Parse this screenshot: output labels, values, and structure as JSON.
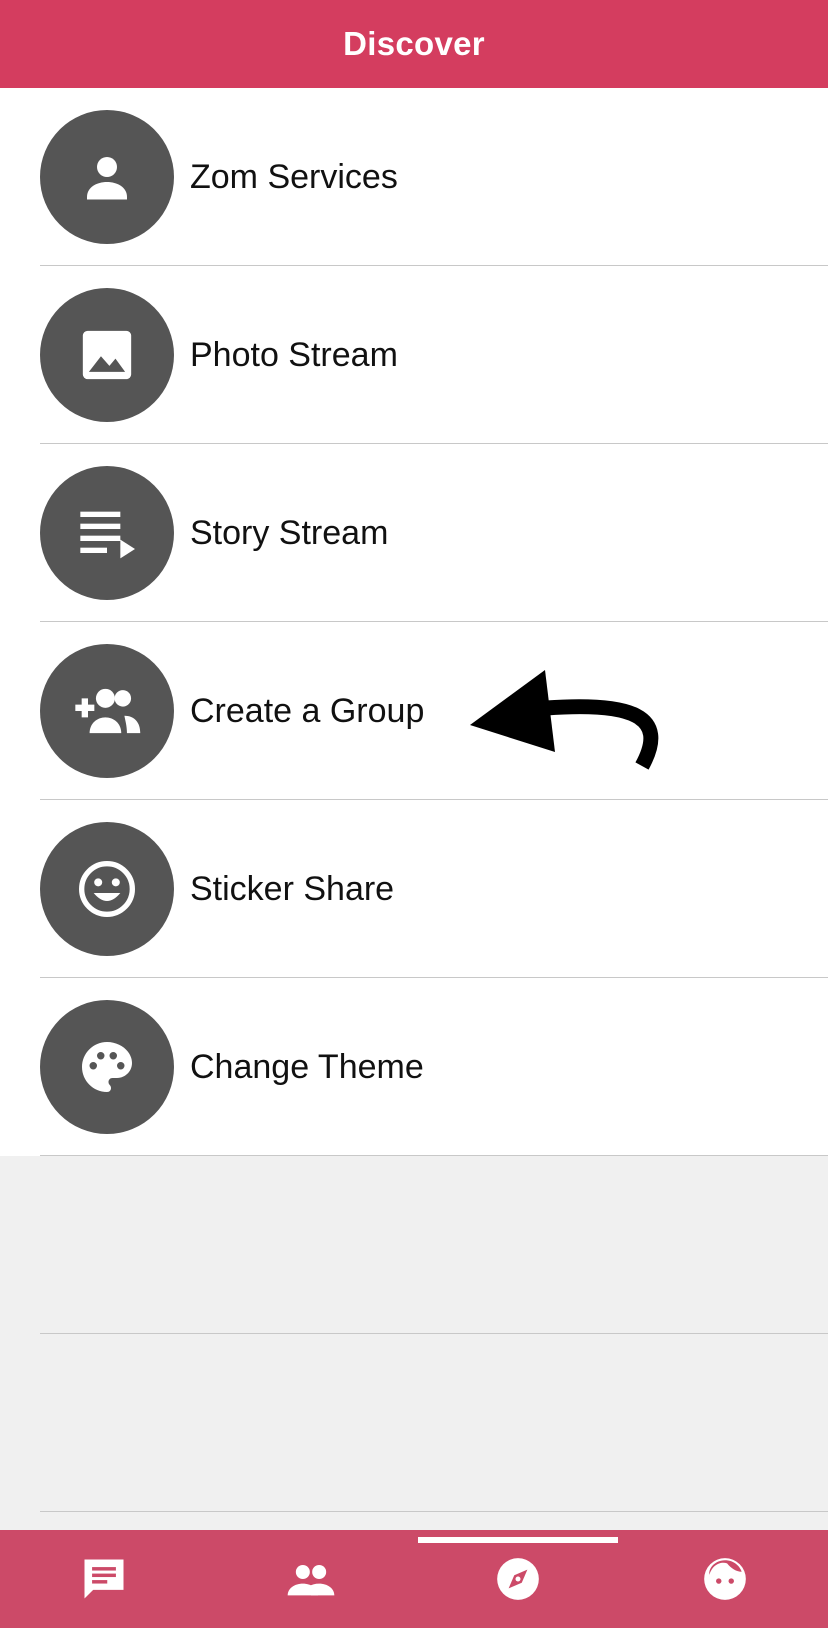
{
  "header": {
    "title": "Discover"
  },
  "items": [
    {
      "label": "Zom Services",
      "icon": "person-icon"
    },
    {
      "label": "Photo Stream",
      "icon": "image-icon"
    },
    {
      "label": "Story Stream",
      "icon": "playlist-play-icon"
    },
    {
      "label": "Create a Group",
      "icon": "group-add-icon"
    },
    {
      "label": "Sticker Share",
      "icon": "smiley-icon"
    },
    {
      "label": "Change Theme",
      "icon": "palette-icon"
    }
  ],
  "tabs": [
    {
      "name": "chats",
      "icon": "chat-icon",
      "active": false
    },
    {
      "name": "contacts",
      "icon": "people-icon",
      "active": false
    },
    {
      "name": "discover",
      "icon": "compass-icon",
      "active": true
    },
    {
      "name": "profile",
      "icon": "face-icon",
      "active": false
    }
  ],
  "colors": {
    "accent": "#d43d5f",
    "tabbar": "#cc4a68",
    "icon_circle": "#555555",
    "empty_area": "#f0f0f0"
  }
}
